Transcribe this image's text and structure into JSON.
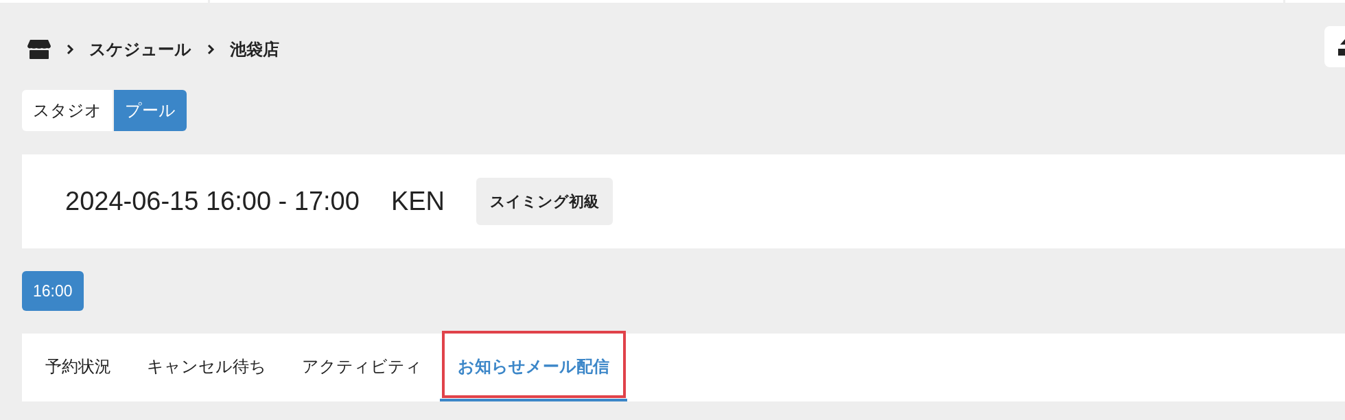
{
  "breadcrumb": {
    "items": [
      "スケジュール",
      "池袋店"
    ]
  },
  "facility_tabs": [
    {
      "label": "スタジオ",
      "selected": false
    },
    {
      "label": "プール",
      "selected": true
    }
  ],
  "lesson": {
    "datetime": "2024-06-15 16:00 - 17:00",
    "instructor": "KEN",
    "tag": "スイミング初級"
  },
  "time_slots": [
    {
      "label": "16:00",
      "selected": true
    }
  ],
  "tabs": [
    {
      "label": "予約状況",
      "selected": false,
      "highlighted": false
    },
    {
      "label": "キャンセル待ち",
      "selected": false,
      "highlighted": false
    },
    {
      "label": "アクティビティ",
      "selected": false,
      "highlighted": false
    },
    {
      "label": "お知らせメール配信",
      "selected": true,
      "highlighted": true
    }
  ]
}
